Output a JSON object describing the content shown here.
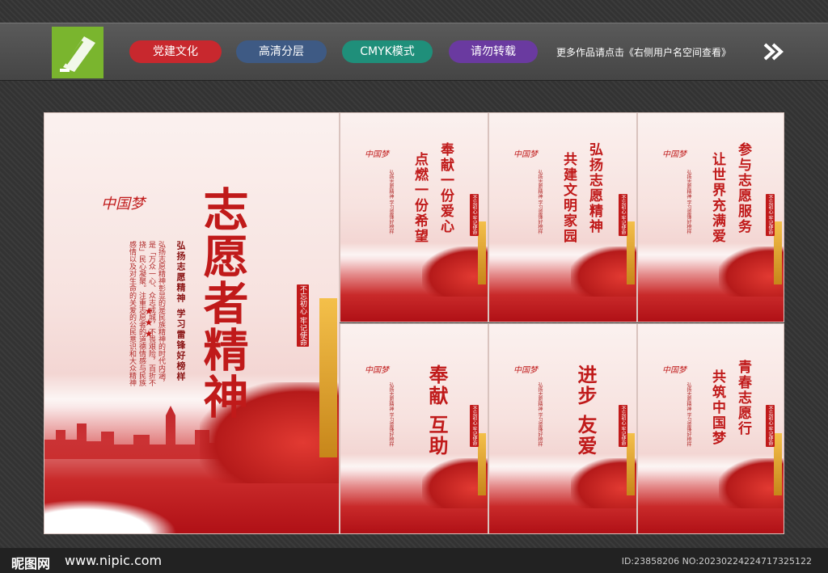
{
  "topbar": {
    "tags": [
      "党建文化",
      "高清分层",
      "CMYK模式",
      "请勿转载"
    ],
    "note": "更多作品请点击《右侧用户名空间查看》"
  },
  "main_poster": {
    "title": "志愿者精神",
    "slogan": "弘扬志愿精神 学习雷锋好榜样",
    "body": "弘扬志愿精神彰显的是民族精神的时代内涵，是「万众一心、众志成城，不畏艰险，百折不挠」民心凝聚。注重志愿者的道德情感与民族感情以及对生命的关爱的公民意识和大众精神",
    "seal": "不忘初心 牢记使命",
    "brand": "中国梦"
  },
  "small_posters": [
    {
      "line1": "奉献一份爱心",
      "line2": "点燃一份希望",
      "brand": "中国梦",
      "slogan": "弘扬志愿精神 学习雷锋好榜样",
      "seal": "不忘初心 牢记使命"
    },
    {
      "line1": "弘扬志愿精神",
      "line2": "共建文明家园",
      "brand": "中国梦",
      "slogan": "弘扬志愿精神 学习雷锋好榜样",
      "seal": "不忘初心 牢记使命"
    },
    {
      "line1": "参与志愿服务",
      "line2": "让世界充满爱",
      "brand": "中国梦",
      "slogan": "弘扬志愿精神 学习雷锋好榜样",
      "seal": "不忘初心 牢记使命"
    },
    {
      "line1": "奉献",
      "line2": "互助",
      "brand": "中国梦",
      "slogan": "弘扬志愿精神 学习雷锋好榜样",
      "seal": "不忘初心 牢记使命"
    },
    {
      "line1": "进步",
      "line2": "友爱",
      "brand": "中国梦",
      "slogan": "弘扬志愿精神 学习雷锋好榜样",
      "seal": "不忘初心 牢记使命"
    },
    {
      "line1": "青春志愿行",
      "line2": "共筑中国梦",
      "brand": "中国梦",
      "slogan": "弘扬志愿精神 学习雷锋好榜样",
      "seal": "不忘初心 牢记使命"
    }
  ],
  "footer": {
    "site_name": "昵图网",
    "url": "www.nipic.com",
    "id": "ID:23858206 NO:20230224224717325122"
  }
}
